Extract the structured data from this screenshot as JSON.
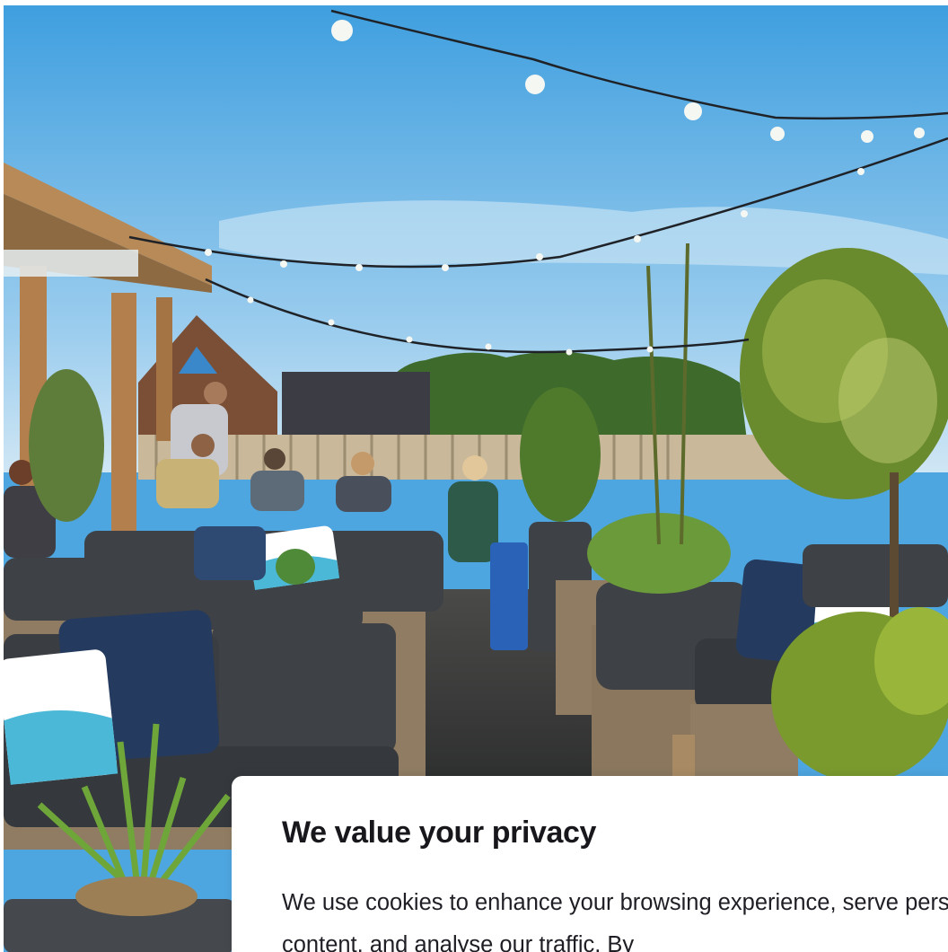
{
  "consent": {
    "title": "We value your privacy",
    "body": "We use cookies to enhance your browsing experience, serve personalised ads or content, and analyse our traffic. By"
  },
  "colors": {
    "sky_top": "#3f9fdf",
    "sky_bottom": "#bfe0f2",
    "cushion": "#3e4146",
    "wicker": "#8f7c63",
    "pillow_teal": "#4ab8d6",
    "pillow_navy": "#243a5e",
    "foliage": "#6a8a2e",
    "bin_blue": "#2a62b8",
    "panel_bg": "#ffffff",
    "title_text": "#17171c"
  },
  "icons": {
    "hero": "rooftop-terrace-photo"
  }
}
